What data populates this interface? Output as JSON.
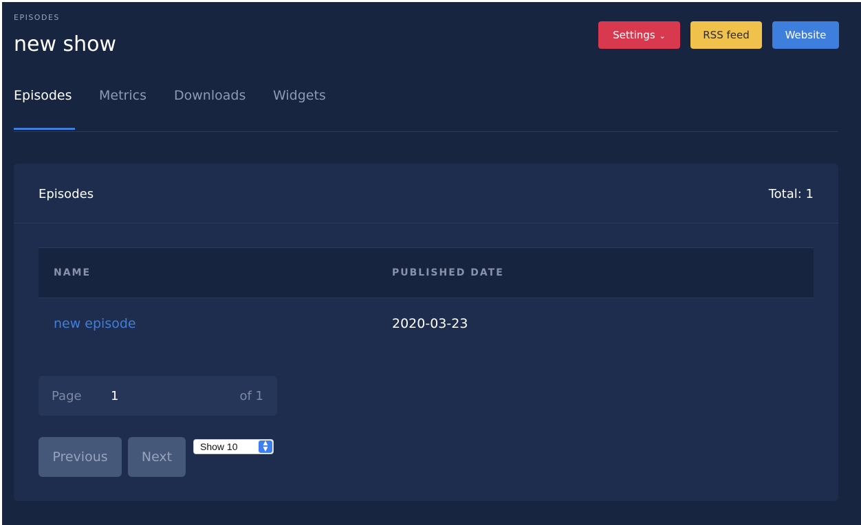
{
  "header": {
    "pretitle": "EPISODES",
    "title": "new show",
    "buttons": {
      "settings": "Settings",
      "rss": "RSS feed",
      "website": "Website"
    }
  },
  "tabs": [
    {
      "label": "Episodes",
      "active": true
    },
    {
      "label": "Metrics",
      "active": false
    },
    {
      "label": "Downloads",
      "active": false
    },
    {
      "label": "Widgets",
      "active": false
    }
  ],
  "card": {
    "title": "Episodes",
    "total": "Total: 1",
    "columns": [
      "NAME",
      "PUBLISHED DATE"
    ],
    "rows": [
      {
        "name": "new episode",
        "published": "2020-03-23"
      }
    ],
    "pagination": {
      "page_label": "Page",
      "page_value": "1",
      "of_label": "of 1",
      "previous": "Previous",
      "next": "Next",
      "page_size": "Show 10"
    }
  },
  "colors": {
    "background": "#182541",
    "card": "#1e2d4d",
    "settings": "#d9394e",
    "rss": "#f0c24c",
    "website": "#3e7fdd",
    "link": "#3e7fdd"
  }
}
